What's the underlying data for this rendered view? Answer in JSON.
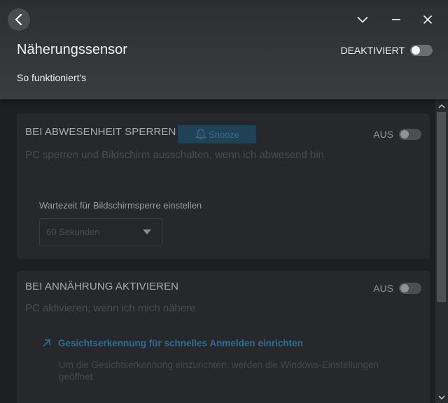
{
  "header": {
    "title": "Näherungssensor",
    "how_it_works": "So funktioniert's",
    "master_state": "DEAKTIVIERT"
  },
  "icons": {
    "back": "back-arrow-icon",
    "collapse": "chevron-down-icon",
    "minimize": "minimize-icon",
    "close": "close-icon"
  },
  "lock_card": {
    "title": "BEI ABWESENHEIT SPERREN",
    "snooze_label": "Snooze",
    "state": "AUS",
    "description": "PC sperren und Bildschirm ausschalten, wenn ich abwesend bin",
    "wait_label": "Wartezeit für Bildschirmsperre einstellen",
    "wait_value": "60 Sekunden"
  },
  "wake_card": {
    "title": "BEI ANNÄHRUNG AKTIVIEREN",
    "state": "AUS",
    "description": "PC aktivieren, wenn ich mich nähere",
    "link": "Gesichtserkennung für schnelles Anmelden einrichten",
    "link_note": "Um die Gesichtserkennung einzurichten, werden die Windows-Einstellungen geöffnet"
  },
  "colors": {
    "background": "#1e1f22",
    "card": "#26282c",
    "link": "#2b6f96",
    "snooze_bg": "#1f4258"
  }
}
